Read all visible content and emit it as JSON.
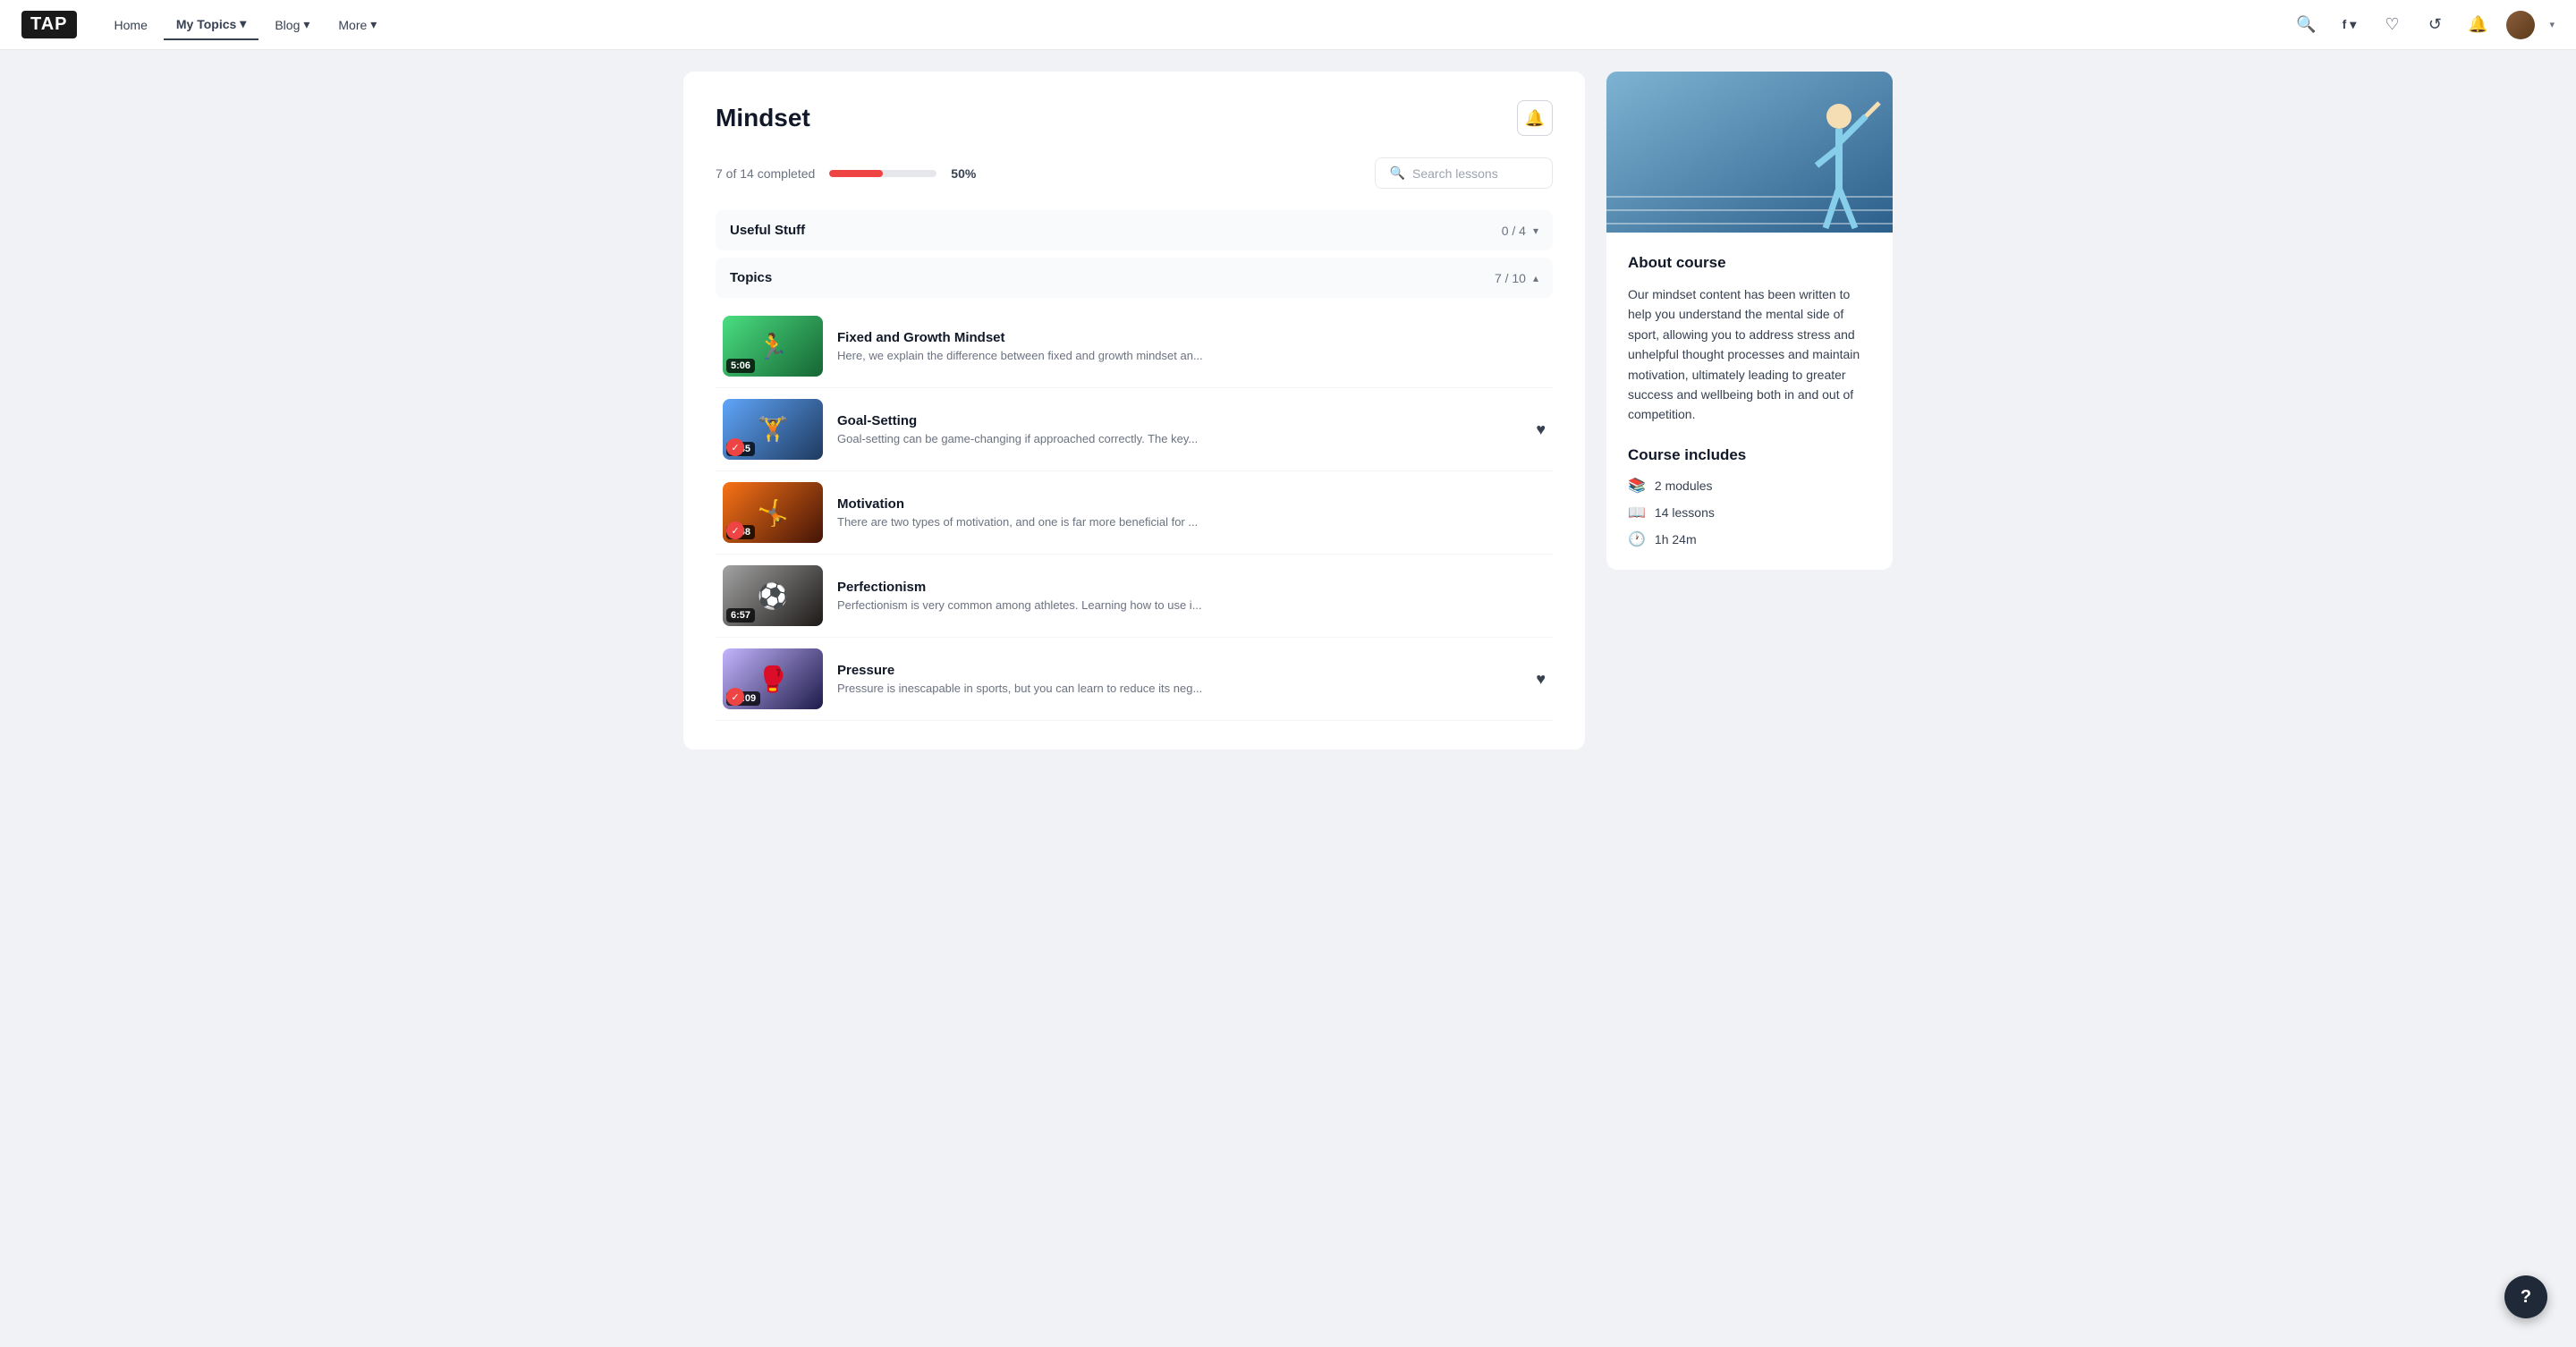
{
  "nav": {
    "logo": "TAP",
    "links": [
      {
        "label": "Home",
        "active": false
      },
      {
        "label": "My Topics",
        "active": true,
        "arrow": "▾"
      },
      {
        "label": "Blog",
        "active": false,
        "arrow": "▾"
      },
      {
        "label": "More",
        "active": false,
        "arrow": "▾"
      }
    ]
  },
  "course": {
    "title": "Mindset",
    "progress": {
      "completed": 7,
      "total": 14,
      "label": "7 of 14 completed",
      "percent": 50,
      "percent_label": "50%",
      "bar_width": "50%"
    },
    "search_placeholder": "Search lessons"
  },
  "sections": [
    {
      "title": "Useful Stuff",
      "count": "0 / 4",
      "expanded": false
    },
    {
      "title": "Topics",
      "count": "7 / 10",
      "expanded": true
    }
  ],
  "lessons": [
    {
      "id": 1,
      "title": "Fixed and Growth Mindset",
      "description": "Here, we explain the difference between fixed and growth mindset an...",
      "duration": "5:06",
      "completed": false,
      "heart": false,
      "thumb_class": "thumb-1",
      "thumb_emoji": "🏃"
    },
    {
      "id": 2,
      "title": "Goal-Setting",
      "description": "Goal-setting can be game-changing if approached correctly. The key...",
      "duration": "3:45",
      "completed": true,
      "heart": true,
      "thumb_class": "thumb-2",
      "thumb_emoji": "🏋️"
    },
    {
      "id": 3,
      "title": "Motivation",
      "description": "There are two types of motivation, and one is far more beneficial for ...",
      "duration": "6:58",
      "completed": true,
      "heart": false,
      "thumb_class": "thumb-3",
      "thumb_emoji": "🤸"
    },
    {
      "id": 4,
      "title": "Perfectionism",
      "description": "Perfectionism is very common among athletes. Learning how to use i...",
      "duration": "6:57",
      "completed": false,
      "heart": false,
      "thumb_class": "thumb-4",
      "thumb_emoji": "⚽"
    },
    {
      "id": 5,
      "title": "Pressure",
      "description": "Pressure is inescapable in sports, but you can learn to reduce its neg...",
      "duration": "15:09",
      "completed": true,
      "heart": true,
      "thumb_class": "thumb-5",
      "thumb_emoji": "🥊"
    }
  ],
  "sidebar": {
    "image_alt": "Athlete",
    "about_title": "About course",
    "about_text": "Our mindset content has been written to help you understand the mental side of sport, allowing you to address stress and unhelpful thought processes and maintain motivation, ultimately leading to greater success and wellbeing both in and out of competition.",
    "includes_title": "Course includes",
    "includes": [
      {
        "icon": "📚",
        "label": "2 modules"
      },
      {
        "icon": "📖",
        "label": "14 lessons"
      },
      {
        "icon": "🕐",
        "label": "1h 24m"
      }
    ]
  },
  "help_label": "?"
}
